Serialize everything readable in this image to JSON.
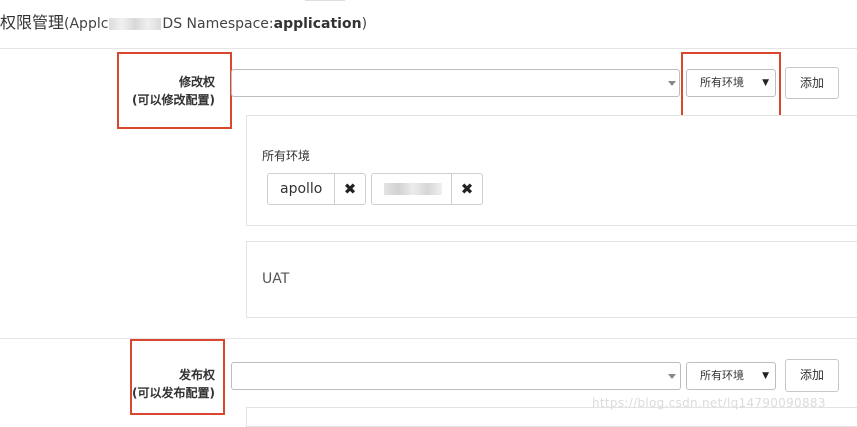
{
  "header": {
    "title_main": "权限管理",
    "title_prefix": "(Applc",
    "title_suffix": "DS Namespace:",
    "namespace_name": "application",
    "title_close": ")"
  },
  "modify": {
    "label_line1": "修改权",
    "label_line2": "(可以修改配置)",
    "user_select_value": "",
    "env_select_value": "所有环境",
    "add_button": "添加",
    "env_groups": [
      {
        "env": "所有环境",
        "users": [
          "apollo",
          ""
        ]
      },
      {
        "env": "UAT",
        "users": []
      }
    ]
  },
  "release": {
    "label_line1": "发布权",
    "label_line2": "(可以发布配置)",
    "user_select_value": "",
    "env_select_value": "所有环境",
    "add_button": "添加"
  },
  "icons": {
    "remove": "✖",
    "dropdown": "▼"
  },
  "colors": {
    "highlight": "#d9472f"
  },
  "watermark": "https://blog.csdn.net/lq14790090883"
}
